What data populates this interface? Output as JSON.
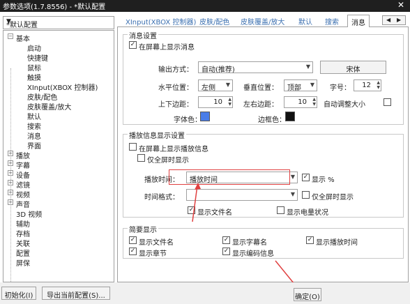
{
  "window": {
    "title": "参数选项(1.7.8556) - *默认配置",
    "close_glyph": "✕"
  },
  "profile": {
    "selected": "*默认配置"
  },
  "tree": {
    "items": [
      {
        "label": "基本",
        "expander": "−"
      },
      {
        "label": "启动"
      },
      {
        "label": "快捷键"
      },
      {
        "label": "鼠标"
      },
      {
        "label": "触摸"
      },
      {
        "label": "XInput(XBOX 控制器)"
      },
      {
        "label": "皮肤/配色"
      },
      {
        "label": "皮肤覆盖/放大"
      },
      {
        "label": "默认"
      },
      {
        "label": "搜索"
      },
      {
        "label": "消息"
      },
      {
        "label": "界面"
      },
      {
        "label": "播放",
        "expander": "+"
      },
      {
        "label": "字幕",
        "expander": "+"
      },
      {
        "label": "设备",
        "expander": "+"
      },
      {
        "label": "滤镜",
        "expander": "+"
      },
      {
        "label": "视频",
        "expander": "+"
      },
      {
        "label": "声音",
        "expander": "+"
      },
      {
        "label": "3D 视频"
      },
      {
        "label": "辅助"
      },
      {
        "label": "存档"
      },
      {
        "label": "关联"
      },
      {
        "label": "配置"
      },
      {
        "label": "屏保"
      }
    ]
  },
  "tabs": [
    {
      "label": "XInput(XBOX 控制器)"
    },
    {
      "label": "皮肤/配色"
    },
    {
      "label": "皮肤覆盖/放大"
    },
    {
      "label": "默认"
    },
    {
      "label": "搜索"
    },
    {
      "label": "消息",
      "active": true
    }
  ],
  "tab_scroll": {
    "left": "◀",
    "right": "▶"
  },
  "messages": {
    "title": "消息设置",
    "show_on_screen": "在屏幕上显示消息",
    "output_label": "输出方式：",
    "output_value": "自动(推荐)",
    "font_button": "宋体",
    "halign_label": "水平位置：",
    "halign_value": "左侧",
    "valign_label": "垂直位置：",
    "valign_value": "顶部",
    "fontsize_label": "字号：",
    "fontsize_value": "12",
    "tb_margin_label": "上下边距：",
    "tb_margin_value": "10",
    "lr_margin_label": "左右边距：",
    "lr_margin_value": "10",
    "auto_size_label": "自动调整大小",
    "font_color_label": "字体色：",
    "border_color_label": "边框色：",
    "font_color": "#4a7de8",
    "border_color": "#111111"
  },
  "playback_info": {
    "title": "播放信息显示设置",
    "show_on_screen": "在屏幕上显示播放信息",
    "fullscreen_only": "仅全屏时显示",
    "play_time_label": "播放时间：",
    "play_time_value": "播放时间",
    "show_percent": "显示 %",
    "time_format_label": "时间格式：",
    "time_format_value": "",
    "fullscreen_only2": "仅全屏时显示",
    "show_filename": "显示文件名",
    "show_battery": "显示电量状况"
  },
  "brief": {
    "title": "简要显示",
    "show_filename": "显示文件名",
    "show_subtitle_name": "显示字幕名",
    "show_play_time": "显示播放时间",
    "show_chapter": "显示章节",
    "show_codec": "显示编码信息"
  },
  "footer": {
    "init_button": "初始化(I)",
    "export_button": "导出当前配置(S)...",
    "ok_button": "确定(O)"
  }
}
